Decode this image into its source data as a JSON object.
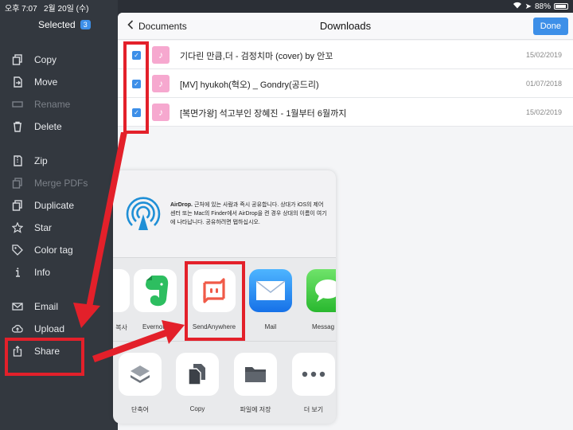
{
  "status": {
    "time": "오후 7:07",
    "date": "2월 20일 (수)",
    "battery": "88%"
  },
  "sidebar": {
    "header": "Selected",
    "count": "3",
    "items": [
      {
        "label": "Copy",
        "icon": "copy-icon"
      },
      {
        "label": "Move",
        "icon": "move-icon"
      },
      {
        "label": "Rename",
        "icon": "rename-icon"
      },
      {
        "label": "Delete",
        "icon": "trash-icon"
      },
      {
        "label": "Zip",
        "icon": "zip-icon"
      },
      {
        "label": "Merge PDFs",
        "icon": "merge-icon"
      },
      {
        "label": "Duplicate",
        "icon": "duplicate-icon"
      },
      {
        "label": "Star",
        "icon": "star-icon"
      },
      {
        "label": "Color tag",
        "icon": "tag-icon"
      },
      {
        "label": "Info",
        "icon": "info-icon"
      },
      {
        "label": "Email",
        "icon": "mail-icon"
      },
      {
        "label": "Upload",
        "icon": "upload-icon"
      },
      {
        "label": "Share",
        "icon": "share-icon"
      }
    ]
  },
  "nav": {
    "back_label": "Documents",
    "title": "Downloads",
    "done_label": "Done"
  },
  "files": [
    {
      "name": "기다린 만큼,더 - 검정치마 (cover) by 안꼬",
      "date": "15/02/2019"
    },
    {
      "name": "[MV] hyukoh(혁오) _ Gondry(공드리)",
      "date": "01/07/2018"
    },
    {
      "name": "[복면가왕] 석고부인 장혜진 - 1월부터 6월까지",
      "date": "15/02/2019"
    }
  ],
  "share": {
    "airdrop_title": "AirDrop.",
    "airdrop_text": " 근처에 있는 사람과 즉시 공유합니다. 상대가 iOS의 제어 센터 또는 Mac의 Finder에서 AirDrop을 켠 경우 상대의 이름이 여기에 나타납니다. 공유하려면 탭하십시오.",
    "apps": [
      {
        "label": "복사",
        "icon": "copy-app-icon"
      },
      {
        "label": "Evernote",
        "icon": "evernote-icon"
      },
      {
        "label": "SendAnywhere",
        "icon": "sendanywhere-icon"
      },
      {
        "label": "Mail",
        "icon": "mail-app-icon"
      },
      {
        "label": "Messag",
        "icon": "messages-icon"
      }
    ],
    "actions": [
      {
        "label": "단축어",
        "icon": "shortcuts-icon"
      },
      {
        "label": "Copy",
        "icon": "copy-doc-icon"
      },
      {
        "label": "파일에 저장",
        "icon": "folder-icon"
      },
      {
        "label": "더 보기",
        "icon": "more-icon"
      }
    ]
  },
  "colors": {
    "accent": "#3d8fe8",
    "highlight": "#e3202a"
  }
}
